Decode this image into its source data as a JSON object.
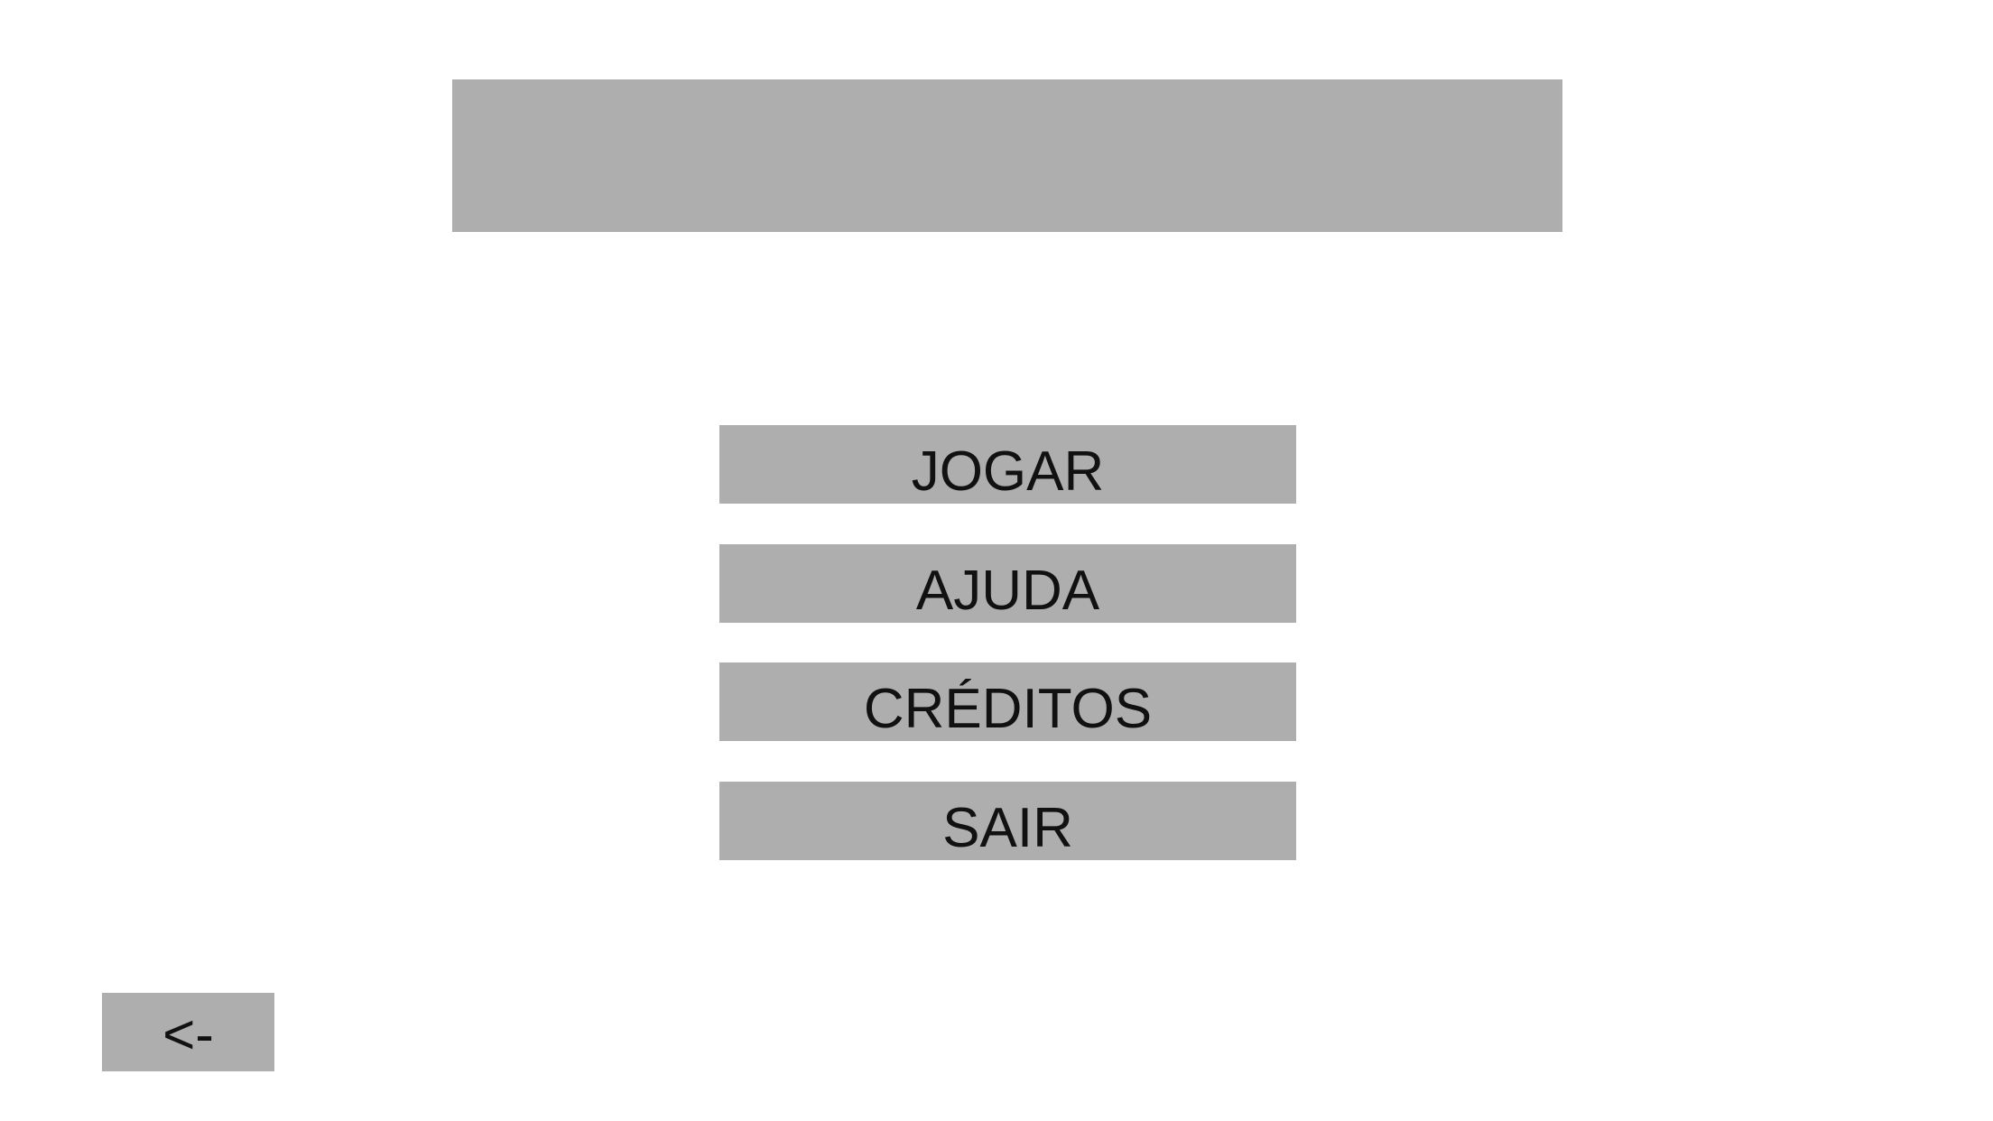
{
  "menu": {
    "items": [
      {
        "id": "jogar",
        "label": "JOGAR"
      },
      {
        "id": "ajuda",
        "label": "AJUDA"
      },
      {
        "id": "creditos",
        "label": "CRÉDITOS"
      },
      {
        "id": "sair",
        "label": "SAIR"
      }
    ]
  },
  "navigation": {
    "back_label": "<-"
  },
  "colors": {
    "background": "#ffffff",
    "panel": "#aeaeae",
    "text": "#111111"
  }
}
